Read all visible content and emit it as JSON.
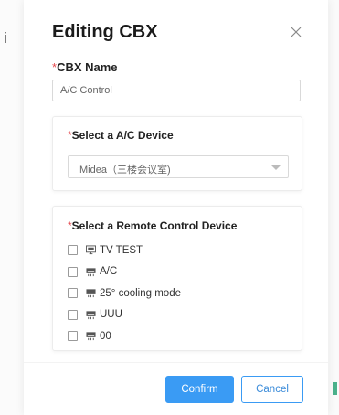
{
  "backdrop": {
    "left_glyph": "i"
  },
  "modal": {
    "title": "Editing CBX",
    "close_icon": "close-icon"
  },
  "cbx_name": {
    "required_mark": "*",
    "label": "CBX Name",
    "value": "A/C Control"
  },
  "ac_device": {
    "required_mark": "*",
    "label": "Select a A/C Device",
    "selected": "Midea（三楼会议室)"
  },
  "remote_devices": {
    "required_mark": "*",
    "label": "Select a Remote Control Device",
    "items": [
      {
        "icon": "tv-icon",
        "name": "TV TEST",
        "checked": false
      },
      {
        "icon": "ac-unit-icon",
        "name": "A/C",
        "checked": false
      },
      {
        "icon": "ac-unit-icon",
        "name": "25° cooling mode",
        "checked": false
      },
      {
        "icon": "ac-unit-icon",
        "name": "UUU",
        "checked": false
      },
      {
        "icon": "ac-unit-icon",
        "name": "00",
        "checked": false
      }
    ]
  },
  "footer": {
    "confirm_label": "Confirm",
    "cancel_label": "Cancel"
  },
  "colors": {
    "primary": "#3a9bf4",
    "required": "#e5484d",
    "border": "#d9d9d9"
  }
}
